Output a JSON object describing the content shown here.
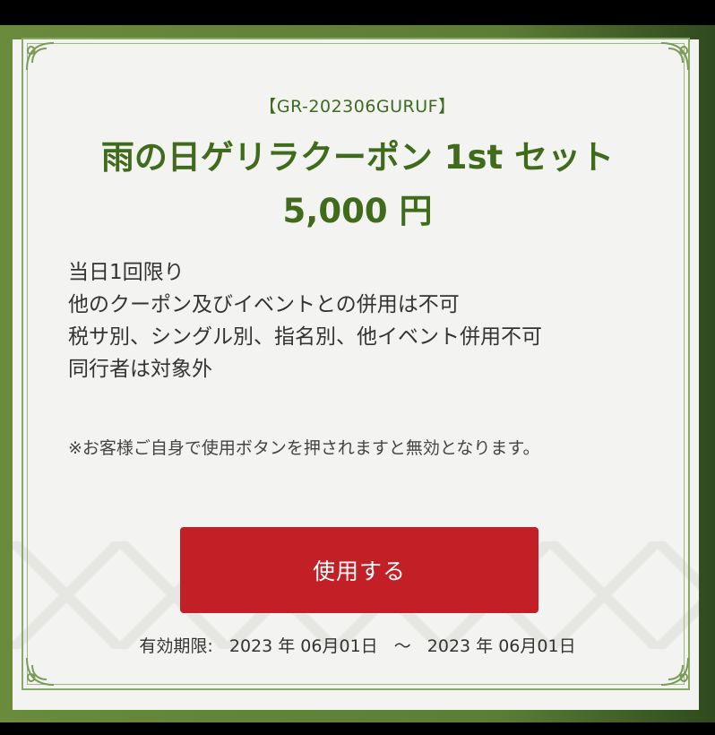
{
  "coupon": {
    "code": "【GR-202306GURUF】",
    "title": "雨の日ゲリラクーポン 1st セット 5,000 円",
    "terms": [
      "当日1回限り",
      "他のクーポン及びイベントとの併用は不可",
      "税サ別、シングル別、指名別、他イベント併用不可",
      "同行者は対象外"
    ],
    "note": "※お客様ご自身で使用ボタンを押されますと無効となります。",
    "use_button_label": "使用する",
    "validity": {
      "label": "有効期限:",
      "start": "2023 年 06月01日",
      "separator": "～",
      "end": "2023 年 06月01日"
    }
  },
  "colors": {
    "title_green": "#3f6b1b",
    "border_green": "#6a8a3c",
    "button_red": "#c21f27"
  }
}
